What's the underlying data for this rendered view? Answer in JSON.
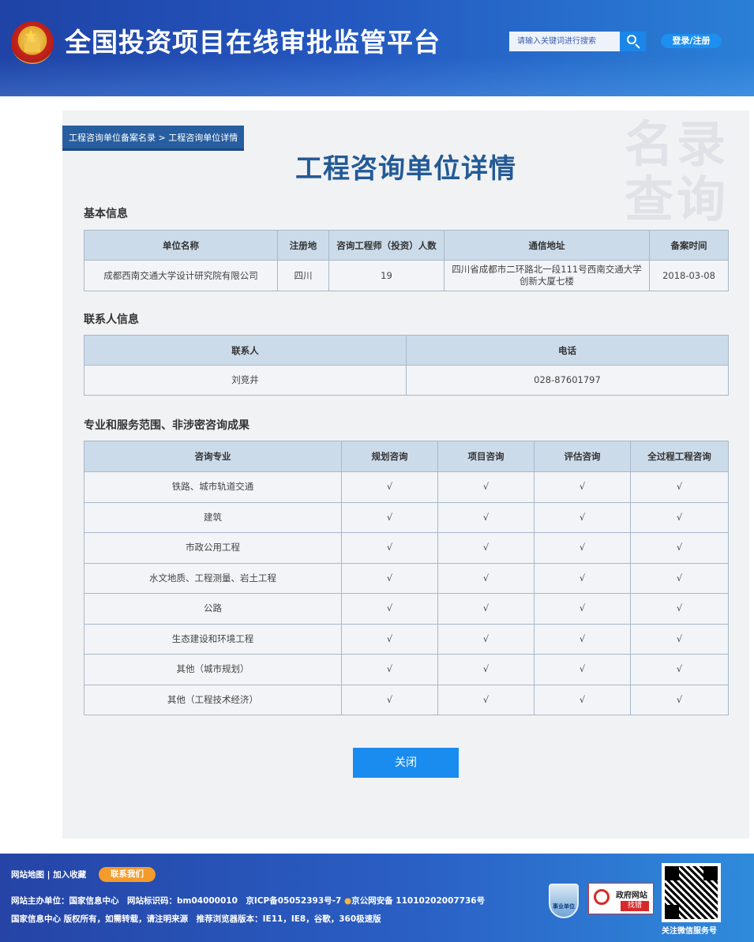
{
  "header": {
    "site_title": "全国投资项目在线审批监管平台",
    "search_placeholder": "请输入关键词进行搜索",
    "login_label": "登录/注册"
  },
  "breadcrumb": "工程咨询单位备案名录 > 工程咨询单位详情",
  "page_title": "工程咨询单位详情",
  "panel_deco": "名录查询",
  "basic_info": {
    "title": "基本信息",
    "headers": [
      "单位名称",
      "注册地",
      "咨询工程师（投资）人数",
      "通信地址",
      "备案时间"
    ],
    "row": [
      "成都西南交通大学设计研究院有限公司",
      "四川",
      "19",
      "四川省成都市二环路北一段111号西南交通大学创新大厦七楼",
      "2018-03-08"
    ]
  },
  "contact_info": {
    "title": "联系人信息",
    "headers": [
      "联系人",
      "电话"
    ],
    "row": [
      "刘竞井",
      "028-87601797"
    ]
  },
  "scope": {
    "title": "专业和服务范围、非涉密咨询成果",
    "headers": [
      "咨询专业",
      "规划咨询",
      "项目咨询",
      "评估咨询",
      "全过程工程咨询"
    ],
    "rows": [
      [
        "铁路、城市轨道交通",
        "√",
        "√",
        "√",
        "√"
      ],
      [
        "建筑",
        "√",
        "√",
        "√",
        "√"
      ],
      [
        "市政公用工程",
        "√",
        "√",
        "√",
        "√"
      ],
      [
        "水文地质、工程测量、岩土工程",
        "√",
        "√",
        "√",
        "√"
      ],
      [
        "公路",
        "√",
        "√",
        "√",
        "√"
      ],
      [
        "生态建设和环境工程",
        "√",
        "√",
        "√",
        "√"
      ],
      [
        "其他（城市规划）",
        "√",
        "√",
        "√",
        "√"
      ],
      [
        "其他（工程技术经济）",
        "√",
        "√",
        "√",
        "√"
      ]
    ]
  },
  "close_label": "关闭",
  "footer": {
    "links": "网站地图 | 加入收藏",
    "contact_label": "联系我们",
    "line1": "网站主办单位：国家信息中心　网站标识码：bm04000010　京ICP备05052393号-7",
    "line1_police": "京公网安备 11010202007736号",
    "line2": "国家信息中心 版权所有，如需转载，请注明来源　推荐浏览器版本：IE11，IE8，谷歌，360极速版",
    "badge_shield": "事业单位",
    "gov_badge_1": "政府网站",
    "gov_badge_2": "找错",
    "qr_label": "关注微信服务号"
  }
}
